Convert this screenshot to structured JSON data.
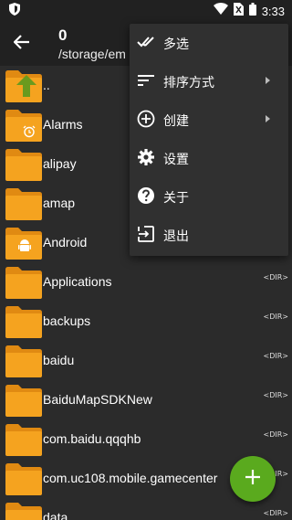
{
  "status_bar": {
    "time": "3:33",
    "icons": [
      "shield-icon",
      "wifi-icon",
      "no-sim-icon",
      "battery-icon"
    ]
  },
  "toolbar": {
    "title": "0",
    "path": "/storage/em"
  },
  "menu": {
    "items": [
      {
        "label": "多选",
        "icon": "double-check-icon",
        "submenu": false
      },
      {
        "label": "排序方式",
        "icon": "sort-icon",
        "submenu": true
      },
      {
        "label": "创建",
        "icon": "add-circle-icon",
        "submenu": true
      },
      {
        "label": "设置",
        "icon": "gear-icon",
        "submenu": false
      },
      {
        "label": "关于",
        "icon": "help-icon",
        "submenu": false
      },
      {
        "label": "退出",
        "icon": "exit-icon",
        "submenu": false
      }
    ]
  },
  "files": [
    {
      "name": "..",
      "badge": "up-arrow",
      "tag": ""
    },
    {
      "name": "Alarms",
      "badge": "alarm",
      "tag": ""
    },
    {
      "name": "alipay",
      "badge": "",
      "tag": ""
    },
    {
      "name": "amap",
      "badge": "",
      "tag": ""
    },
    {
      "name": "Android",
      "badge": "android",
      "tag": ""
    },
    {
      "name": "Applications",
      "badge": "",
      "tag": "<DIR>"
    },
    {
      "name": "backups",
      "badge": "",
      "tag": "<DIR>"
    },
    {
      "name": "baidu",
      "badge": "",
      "tag": "<DIR>"
    },
    {
      "name": "BaiduMapSDKNew",
      "badge": "",
      "tag": "<DIR>"
    },
    {
      "name": "com.baidu.qqqhb",
      "badge": "",
      "tag": "<DIR>"
    },
    {
      "name": "com.uc108.mobile.gamecenter",
      "badge": "",
      "tag": "<DIR>"
    },
    {
      "name": "data",
      "badge": "",
      "tag": "<DIR>"
    }
  ],
  "fab": {
    "icon": "plus-icon"
  },
  "colors": {
    "background": "#2b2b2b",
    "toolbar": "#212121",
    "folder": "#f5a31f",
    "folder_tab": "#e08a12",
    "menu": "#303030",
    "fab": "#5aaa1e"
  }
}
